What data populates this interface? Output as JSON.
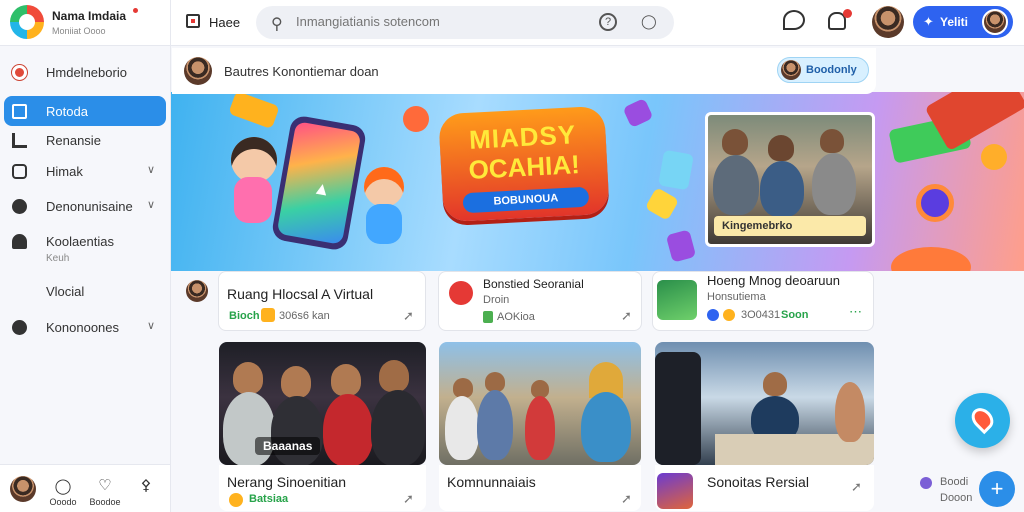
{
  "app": {
    "name": "Nama Imdaia",
    "subtitle": "Moniiat Oooo"
  },
  "topbar": {
    "home_label": "Haee",
    "search_placeholder": "Inmangiatianis sotencom",
    "profile_label": "Yeliti",
    "icons": [
      "home-icon",
      "search-icon",
      "help-icon",
      "user-icon",
      "chat-icon",
      "bell-icon",
      "profile-icon"
    ],
    "accent": "#2e63f0"
  },
  "sidebar": {
    "items": [
      {
        "label": "Hmdelneborio",
        "icon": "globe-icon",
        "chevron": false
      },
      {
        "label": "Rotoda",
        "icon": "home-icon",
        "chevron": false,
        "active": true
      },
      {
        "label": "Renansie",
        "icon": "stats-icon",
        "chevron": false
      },
      {
        "label": "Himak",
        "icon": "instagram-icon",
        "chevron": true
      },
      {
        "label": "Denonunisaine",
        "icon": "people-icon",
        "chevron": true
      },
      {
        "label": "Koolaentias",
        "icon": "person-icon",
        "chevron": false
      },
      {
        "label": "Vlocial",
        "icon": "",
        "chevron": false
      },
      {
        "label": "Kononoones",
        "icon": "group-icon",
        "chevron": true
      }
    ],
    "sub_label": "Keuh",
    "active_color": "#2b8ee8",
    "bottom": [
      {
        "label": "Ooodo",
        "icon": "chat-bubble-icon"
      },
      {
        "label": "Boodoe",
        "icon": "heart-icon"
      },
      {
        "label": "",
        "icon": "share-icon"
      }
    ]
  },
  "postbar": {
    "text": "Bautres Konontiemar doan",
    "button": "Boodonly"
  },
  "banner": {
    "title1": "MIADSY",
    "title2": "OCAHIA!",
    "title3": "BOBUNOUA",
    "photo_caption": "Kingemebrko"
  },
  "feed": {
    "cards": [
      {
        "title": "Ruang Hlocsal A Virtual",
        "meta_green": "Bioch",
        "meta": "306s6 kan",
        "icon": "yellow-badge-icon"
      },
      {
        "title": "Bonstied Seoranial",
        "subtitle": "Droin",
        "meta_green": "",
        "meta": "AOKioa",
        "icon": "red-circle-icon"
      },
      {
        "title": "Hoeng Mnog deoaruun",
        "subtitle": "Honsutiema",
        "meta_green": "Soon",
        "meta": "3O0431",
        "icon": "green-dots-icon"
      }
    ],
    "image_cards": [
      {
        "tag": "Baaanas",
        "title": "Nerang Sinoenitian",
        "sub": "Batsiaa"
      },
      {
        "title": "Komnunnaiais"
      },
      {
        "title": "Sonoitas Rersial"
      }
    ],
    "right_mini": {
      "a": "Boodi",
      "b": "Dooon"
    }
  }
}
